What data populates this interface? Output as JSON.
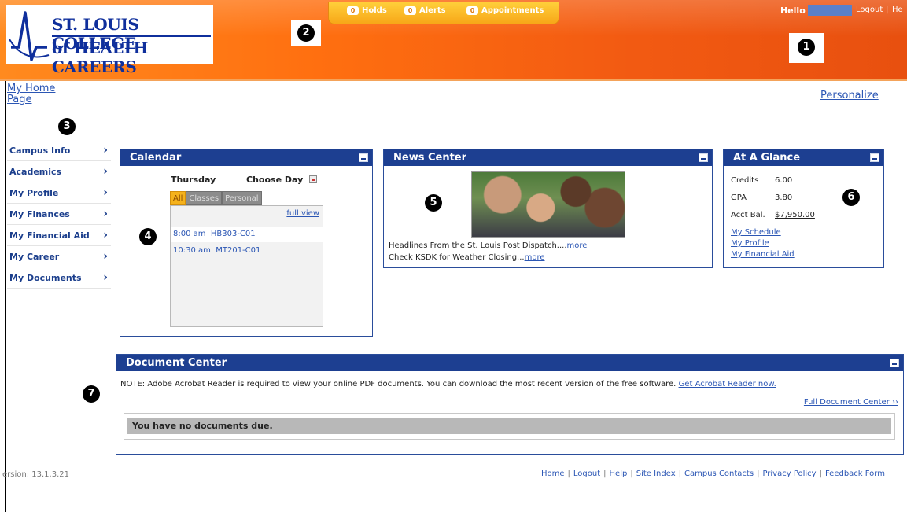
{
  "header": {
    "logo_line1": "ST. LOUIS COLLEGE",
    "logo_line2": "of HEALTH CAREERS",
    "tabs": [
      {
        "count": "0",
        "label": "Holds"
      },
      {
        "count": "0",
        "label": "Alerts"
      },
      {
        "count": "0",
        "label": "Appointments"
      }
    ],
    "hello": "Hello",
    "logout": "Logout",
    "sep": "|",
    "help": "He"
  },
  "callouts": [
    "1",
    "2",
    "3",
    "4",
    "5",
    "6",
    "7"
  ],
  "nav": {
    "home": "My Home Page",
    "personalize": "Personalize"
  },
  "sidebar": {
    "items": [
      {
        "label": "Campus Info",
        "chev": "›"
      },
      {
        "label": "Academics",
        "chev": "›"
      },
      {
        "label": "My Profile",
        "chev": "›"
      },
      {
        "label": "My Finances",
        "chev": "›"
      },
      {
        "label": "My Financial Aid",
        "chev": "›"
      },
      {
        "label": "My Career",
        "chev": "›"
      },
      {
        "label": "My Documents",
        "chev": "›"
      }
    ]
  },
  "calendar": {
    "title": "Calendar",
    "day": "Thursday",
    "choose": "Choose Day",
    "tabs": [
      "All",
      "Classes",
      "Personal"
    ],
    "full_view": "full view",
    "events": [
      {
        "time": "8:00 am",
        "course": "HB303-C01"
      },
      {
        "time": "10:30 am",
        "course": "MT201-C01"
      }
    ]
  },
  "news": {
    "title": "News Center",
    "lines": [
      {
        "text": "Headlines From the St. Louis Post Dispatch....",
        "more": "more"
      },
      {
        "text": "Check KSDK for Weather Closing...",
        "more": "more"
      }
    ]
  },
  "glance": {
    "title": "At A Glance",
    "credits_label": "Credits",
    "credits": "6.00",
    "gpa_label": "GPA",
    "gpa": "3.80",
    "bal_label": "Acct Bal.",
    "bal": "$7,950.00",
    "links": [
      "My Schedule",
      "My Profile",
      "My Financial Aid"
    ]
  },
  "documents": {
    "title": "Document Center",
    "note": "NOTE: Adobe Acrobat Reader is required to view your online PDF documents. You can download the most recent version of the free software.",
    "get_reader": "Get Acrobat Reader now.",
    "full": "Full Document Center ››",
    "empty": "You have no documents due."
  },
  "footer": {
    "version": "ersion: 13.1.3.21",
    "links": [
      "Home",
      "Logout",
      "Help",
      "Site Index",
      "Campus Contacts",
      "Privacy Policy",
      "Feedback Form"
    ]
  },
  "colors": {
    "header_orange": "#ff6f10",
    "panel_blue": "#1d3f91",
    "link_blue": "#2b56b4"
  }
}
